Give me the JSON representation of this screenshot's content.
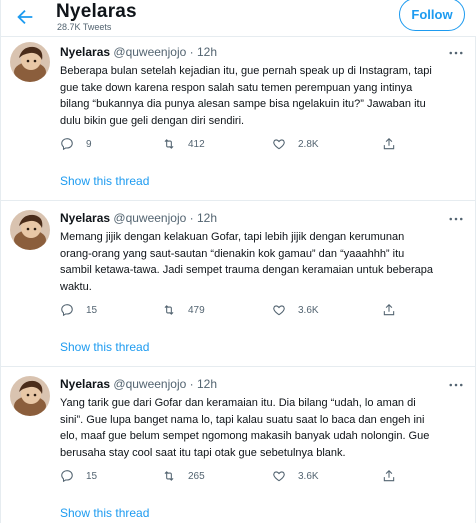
{
  "header": {
    "title": "Nyelaras",
    "tweet_count": "28.7K Tweets",
    "follow_label": "Follow"
  },
  "tweets": [
    {
      "name": "Nyelaras",
      "handle": "@quweenjojo",
      "separator": "·",
      "time": "12h",
      "lines": [
        "Beberapa bulan setelah kejadian itu, gue pernah speak up di Instagram, tapi",
        "gue take down karena respon salah satu temen perempuan yang intinya",
        "bilang “bukannya dia punya alesan sampe bisa ngelakuin itu?” Jawaban itu",
        "dulu bikin gue geli dengan diri sendiri."
      ],
      "replies": "9",
      "retweets": "412",
      "likes": "2.8K",
      "show_thread": "Show this thread"
    },
    {
      "name": "Nyelaras",
      "handle": "@quweenjojo",
      "separator": "·",
      "time": "12h",
      "lines": [
        "Memang jijik dengan kelakuan Gofar, tapi lebih jijik dengan kerumunan",
        "orang-orang yang saut-sautan “dienakin kok gamau” dan “yaaahhh” itu",
        "sambil ketawa-tawa. Jadi sempet trauma dengan keramaian untuk beberapa",
        "waktu."
      ],
      "replies": "15",
      "retweets": "479",
      "likes": "3.6K",
      "show_thread": "Show this thread"
    },
    {
      "name": "Nyelaras",
      "handle": "@quweenjojo",
      "separator": "·",
      "time": "12h",
      "lines": [
        "Yang tarik gue dari Gofar dan keramaian itu. Dia bilang “udah, lo aman di",
        "sini”. Gue lupa banget nama lo, tapi kalau suatu saat lo baca dan engeh ini",
        "elo, maaf gue belum sempet ngomong makasih banyak udah nolongin. Gue",
        "berusaha stay cool saat itu tapi otak gue sebetulnya blank."
      ],
      "replies": "15",
      "retweets": "265",
      "likes": "3.6K",
      "show_thread": "Show this thread"
    }
  ],
  "colors": {
    "accent": "#1d9bf0",
    "text": "#0f1419",
    "muted": "#536471",
    "border": "#e6ecf0"
  },
  "icons": [
    "back-arrow-icon",
    "more-icon",
    "reply-icon",
    "retweet-icon",
    "like-icon",
    "share-icon"
  ]
}
